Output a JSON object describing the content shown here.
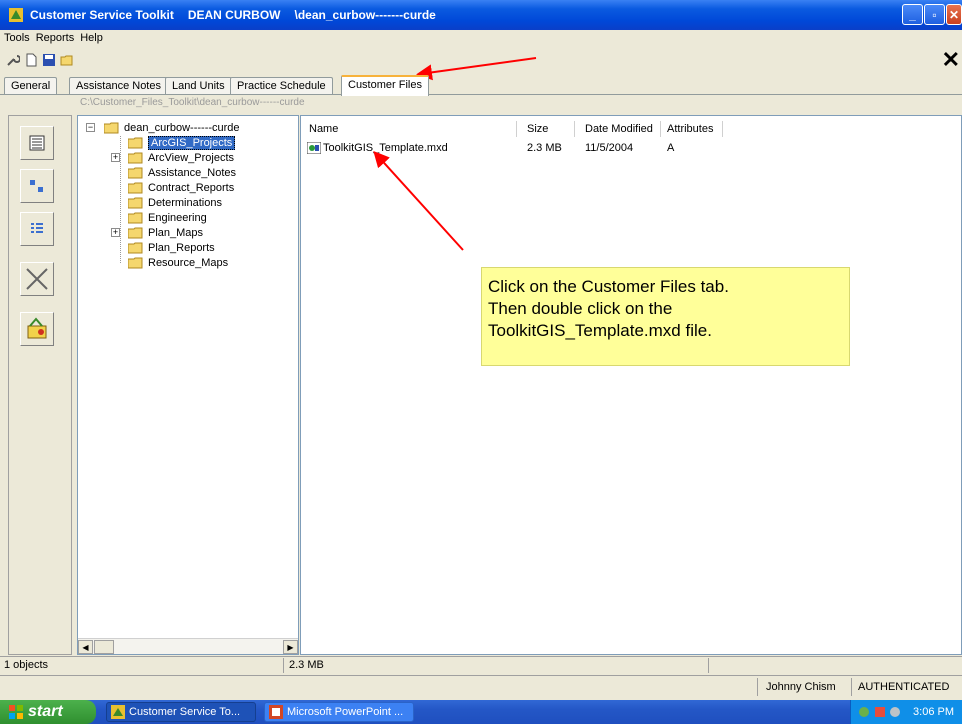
{
  "titlebar": {
    "app": "Customer Service Toolkit",
    "customer": "DEAN CURBOW",
    "path": "\\dean_curbow-------curde"
  },
  "menu": [
    "Tools",
    "Reports",
    "Help"
  ],
  "tabs": [
    "General",
    "Assistance Notes",
    "Land Units",
    "Practice Schedule",
    "Customer Files"
  ],
  "active_tab": "Customer Files",
  "path": "C:\\Customer_Files_Toolkit\\dean_curbow------curde",
  "tree": {
    "root": "dean_curbow------curde",
    "items": [
      "ArcGIS_Projects",
      "ArcView_Projects",
      "Assistance_Notes",
      "Contract_Reports",
      "Determinations",
      "Engineering",
      "Plan_Maps",
      "Plan_Reports",
      "Resource_Maps"
    ],
    "selected": "ArcGIS_Projects"
  },
  "columns": [
    "Name",
    "Size",
    "Date Modified",
    "Attributes"
  ],
  "files": [
    {
      "name": "ToolkitGIS_Template.mxd",
      "size": "2.3 MB",
      "modified": "11/5/2004",
      "attributes": "A"
    }
  ],
  "callout": [
    "Click on the Customer Files tab.",
    "Then double click on the",
    "ToolkitGIS_Template.mxd file."
  ],
  "status": {
    "count": "1 objects",
    "size": "2.3 MB",
    "user": "Johnny Chism",
    "auth": "AUTHENTICATED"
  },
  "taskbar": {
    "start": "start",
    "task1": "Customer Service To...",
    "task2": "Microsoft PowerPoint ...",
    "clock": "3:06 PM"
  },
  "colors": {
    "annotation_arrow": "#ff0000",
    "callout_bg": "#ffff99",
    "selection": "#316ac5"
  }
}
